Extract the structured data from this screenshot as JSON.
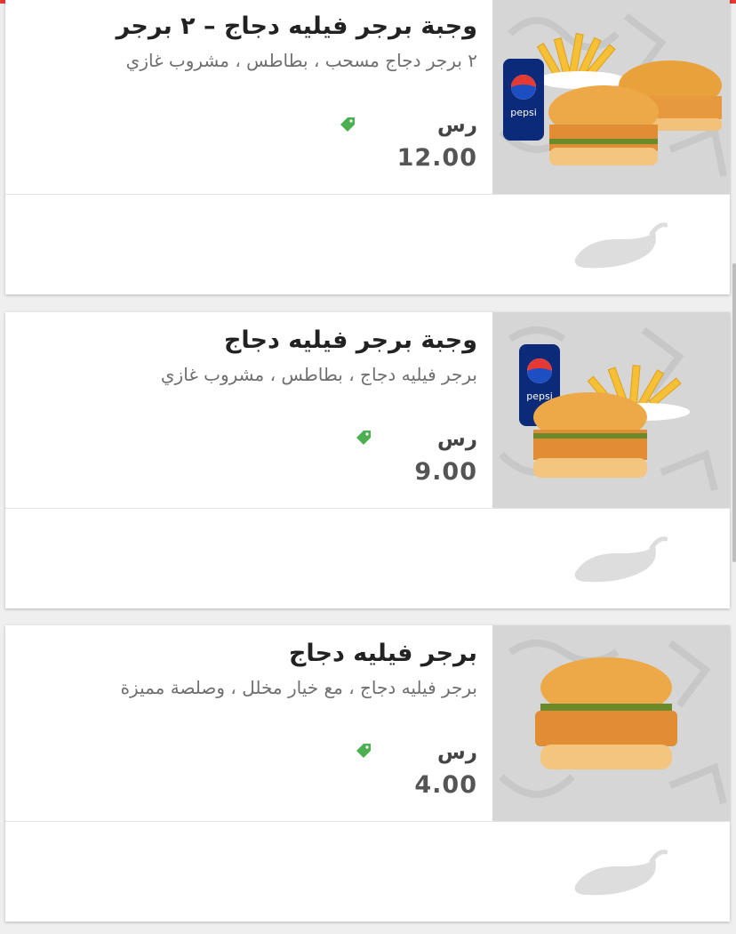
{
  "items": [
    {
      "title": "وجبة برجر فيليه دجاج – ٢ برجر",
      "description": "٢ برجر دجاج مسحب ، بطاطس ، مشروب غازي",
      "currency": "رس",
      "price": "12.00",
      "image": "two-burger-meal-image"
    },
    {
      "title": "وجبة برجر فيليه دجاج",
      "description": "برجر فيليه دجاج ، بطاطس ، مشروب غازي",
      "currency": "رس",
      "price": "9.00",
      "image": "burger-meal-image"
    },
    {
      "title": "برجر فيليه دجاج",
      "description": "برجر فيليه دجاج ، مع خيار مخلل ، وصلصة مميزة",
      "currency": "رس",
      "price": "4.00",
      "image": "burger-image"
    }
  ],
  "icons": {
    "tag": "tag-icon",
    "spice": "chili-pepper-icon"
  },
  "colors": {
    "accent": "#e53935",
    "tag_green": "#4caf50",
    "pepper_gray": "#dddddd",
    "image_bg": "#d6d6d6"
  }
}
